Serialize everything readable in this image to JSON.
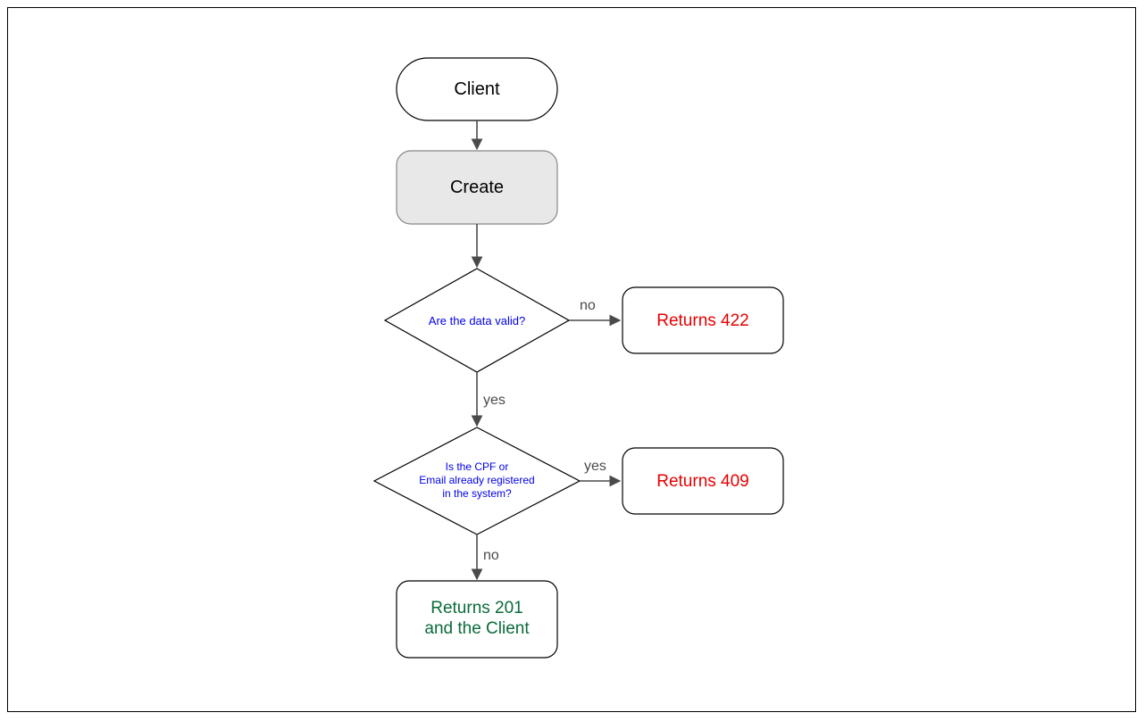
{
  "diagram": {
    "nodes": {
      "client": {
        "label": "Client"
      },
      "create": {
        "label": "Create"
      },
      "valid": {
        "label": "Are the data valid?"
      },
      "return422": {
        "label": "Returns 422"
      },
      "dup": {
        "line1": "Is the CPF or",
        "line2": "Email already registered",
        "line3": "in the system?"
      },
      "return409": {
        "label": "Returns 409"
      },
      "return201": {
        "line1": "Returns 201",
        "line2": "and the Client"
      }
    },
    "edges": {
      "valid_no": "no",
      "valid_yes": "yes",
      "dup_yes": "yes",
      "dup_no": "no"
    }
  }
}
